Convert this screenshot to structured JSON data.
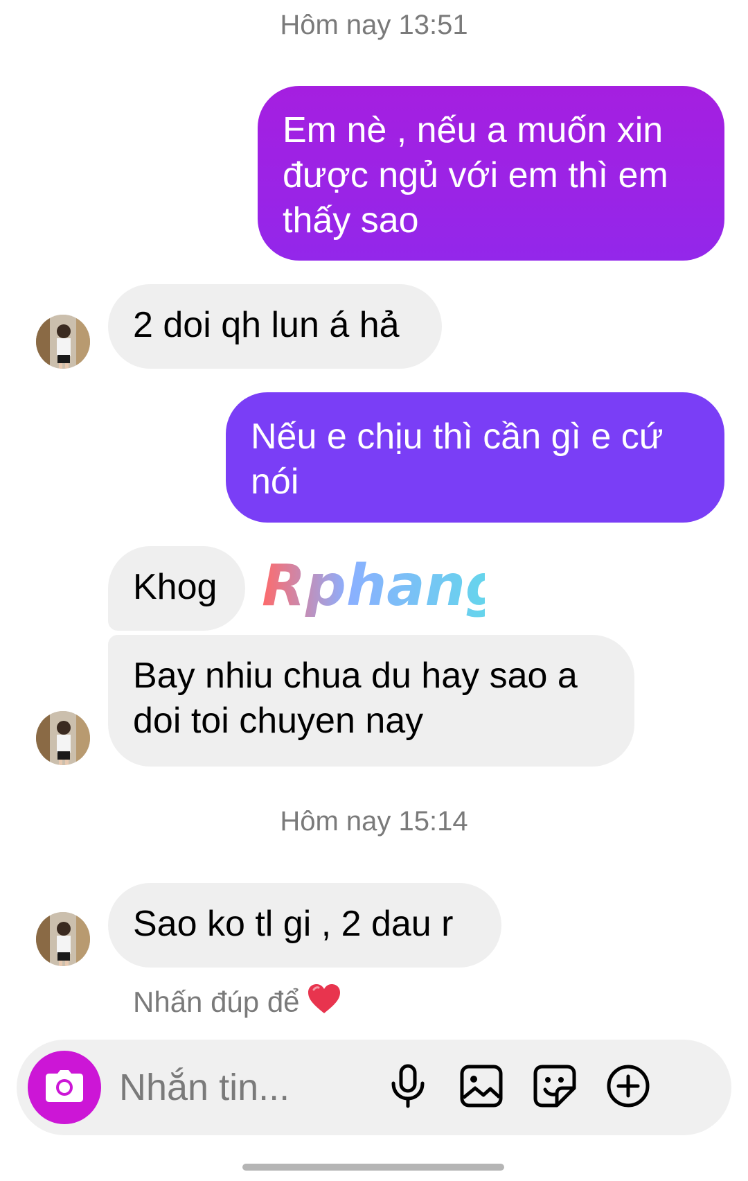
{
  "chat": {
    "timestamp_1": "Hôm nay 13:51",
    "msg_out_1_lines": [
      "Em nè , nếu a muốn xin",
      "được ngủ với em thì em",
      "thấy sao"
    ],
    "msg_in_1": "2 doi qh lun á hả",
    "msg_out_2_lines": [
      "Nếu e chịu thì cần gì e cứ",
      "nói"
    ],
    "msg_in_2": "Khog",
    "msg_in_3_lines": [
      "Bay nhiu chua du hay sao a",
      "doi toi chuyen nay"
    ],
    "timestamp_2": "Hôm nay 15:14",
    "msg_in_4": "Sao ko tl gi , 2 dau r",
    "hint_text": "Nhấn đúp để"
  },
  "watermark": {
    "text": "Rphang"
  },
  "composer": {
    "placeholder": "Nhắn tin...",
    "icons": [
      "camera-icon",
      "microphone-icon",
      "gallery-icon",
      "sticker-icon",
      "plus-icon"
    ]
  },
  "colors": {
    "outgoing_1": "#9b22e6",
    "outgoing_2": "#7a3ef6",
    "incoming": "#efefef",
    "camera_button": "#cc16d6",
    "heart": "#e8344e"
  }
}
